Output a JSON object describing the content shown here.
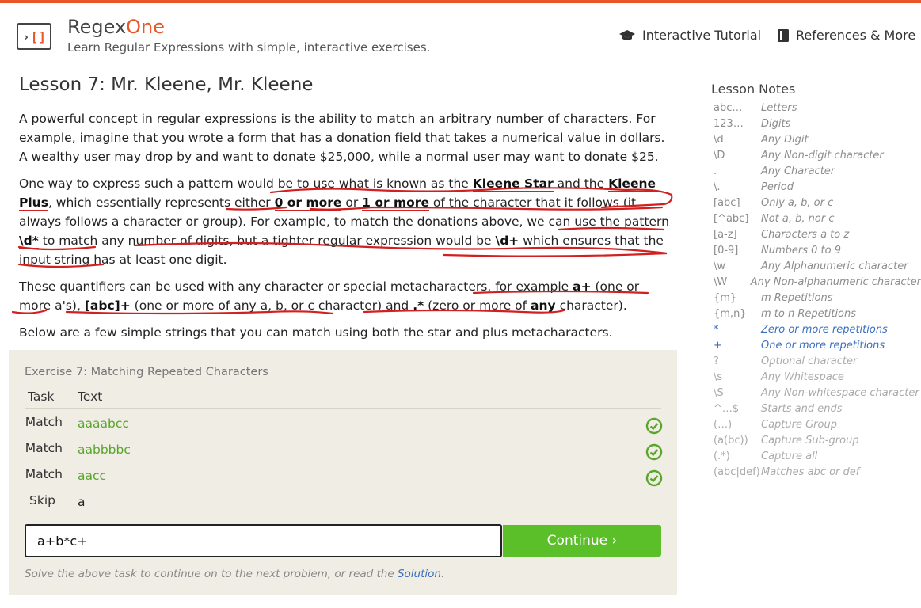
{
  "header": {
    "brand_main": "Regex",
    "brand_accent": "One",
    "tagline": "Learn Regular Expressions with simple, interactive exercises.",
    "nav_tutorial": "Interactive Tutorial",
    "nav_references": "References & More"
  },
  "lesson": {
    "title": "Lesson 7: Mr. Kleene, Mr. Kleene",
    "p1": "A powerful concept in regular expressions is the ability to match an arbitrary number of characters. For example, imagine that you wrote a form that has a donation field that takes a numerical value in dollars. A wealthy user may drop by and want to donate $25,000, while a normal user may want to donate $25.",
    "p2": {
      "t1": "One way to express such a pattern would be to use what is known as the ",
      "b1": "Kleene Star",
      "t2": " and the ",
      "b2": "Kleene Plus",
      "t3": ", which essentially represents either ",
      "b3": "0 or more",
      "t4": " or ",
      "b4": "1 or more",
      "t5": " of the character that it follows (it always follows a character or group). For example, to match the donations above, we can use the pattern ",
      "b5": "\\d*",
      "t6": " to match any number of digits, but a tighter regular expression would be ",
      "b6": "\\d+",
      "t7": " which ensures that the input string has at least one digit."
    },
    "p3": {
      "t1": "These quantifiers can be used with any character or special metacharacters, for example ",
      "b1": "a+",
      "t2": " (one or more a's), ",
      "b2": "[abc]+",
      "t3": " (one or more of any a, b, or c character) and ",
      "b3": ".*",
      "t4": " (zero or more of ",
      "b4": "any",
      "t5": " character)."
    },
    "p4": "Below are a few simple strings that you can match using both the star and plus metacharacters."
  },
  "exercise": {
    "title": "Exercise 7: Matching Repeated Characters",
    "col_task": "Task",
    "col_text": "Text",
    "rows": [
      {
        "task": "Match",
        "text": "aaaabcc",
        "status": "check-circle-icon"
      },
      {
        "task": "Match",
        "text": "aabbbbc",
        "status": "check-circle-icon"
      },
      {
        "task": "Match",
        "text": "aacc",
        "status": "check-circle-icon"
      },
      {
        "task": "Skip",
        "text": "a",
        "status": ""
      }
    ],
    "input_value": "a+b*c+",
    "continue_label": "Continue ›",
    "hint_prefix": "Solve the above task to continue on to the next problem, or read the ",
    "hint_link": "Solution",
    "hint_suffix": "."
  },
  "notes": {
    "title": "Lesson Notes",
    "items": [
      {
        "k": "abc…",
        "v": "Letters"
      },
      {
        "k": "123…",
        "v": "Digits"
      },
      {
        "k": "\\d",
        "v": "Any Digit"
      },
      {
        "k": "\\D",
        "v": "Any Non-digit character"
      },
      {
        "k": ".",
        "v": "Any Character"
      },
      {
        "k": "\\.",
        "v": "Period"
      },
      {
        "k": "[abc]",
        "v": "Only a, b, or c"
      },
      {
        "k": "[^abc]",
        "v": "Not a, b, nor c"
      },
      {
        "k": "[a-z]",
        "v": "Characters a to z"
      },
      {
        "k": "[0-9]",
        "v": "Numbers 0 to 9"
      },
      {
        "k": "\\w",
        "v": "Any Alphanumeric character"
      },
      {
        "k": "\\W",
        "v": "Any Non-alphanumeric character"
      },
      {
        "k": "{m}",
        "v": "m Repetitions"
      },
      {
        "k": "{m,n}",
        "v": "m to n Repetitions"
      },
      {
        "k": "*",
        "v": "Zero or more repetitions"
      },
      {
        "k": "+",
        "v": "One or more repetitions"
      },
      {
        "k": "?",
        "v": "Optional character"
      },
      {
        "k": "\\s",
        "v": "Any Whitespace"
      },
      {
        "k": "\\S",
        "v": "Any Non-whitespace character"
      },
      {
        "k": "^…$",
        "v": "Starts and ends"
      },
      {
        "k": "(…)",
        "v": "Capture Group"
      },
      {
        "k": "(a(bc))",
        "v": "Capture Sub-group"
      },
      {
        "k": "(.*)",
        "v": "Capture all"
      },
      {
        "k": "(abc|def)",
        "v": "Matches abc or def"
      }
    ]
  },
  "colors": {
    "accent": "#e8562a",
    "continue": "#5bbf2a",
    "match_text": "#5aa52c",
    "link": "#3b6fbf",
    "annotation": "#d21f1f"
  }
}
